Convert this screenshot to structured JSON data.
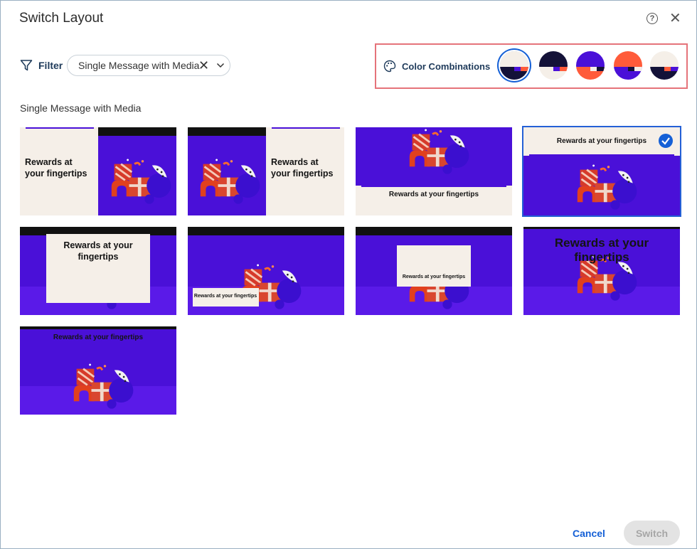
{
  "dialog": {
    "title": "Switch Layout",
    "help_icon": "help-circle-icon",
    "close_icon": "close-icon"
  },
  "filter": {
    "label": "Filter",
    "icon": "filter-funnel-icon",
    "selected": "Single Message with Media"
  },
  "color_combinations": {
    "label": "Color Combinations",
    "icon": "palette-icon",
    "swatches": [
      {
        "name": "cream-navy-purple-orange",
        "colors": [
          "#f5efe8",
          "#141238",
          "#4a10d8",
          "#ff5b3a"
        ],
        "selected": true
      },
      {
        "name": "navy-cream-purple-orange",
        "colors": [
          "#141238",
          "#f5efe8",
          "#4a10d8",
          "#ff5b3a"
        ],
        "selected": false
      },
      {
        "name": "purple-orange-cream-navy",
        "colors": [
          "#4a10d8",
          "#ff5b3a",
          "#f5efe8",
          "#141238"
        ],
        "selected": false
      },
      {
        "name": "orange-purple-navy-cream",
        "colors": [
          "#ff5b3a",
          "#4a10d8",
          "#141238",
          "#f5efe8"
        ],
        "selected": false
      },
      {
        "name": "cream-navy-orange-purple",
        "colors": [
          "#f5efe8",
          "#141238",
          "#ff5b3a",
          "#4a10d8"
        ],
        "selected": false
      }
    ]
  },
  "section": {
    "label": "Single Message with Media"
  },
  "layouts": [
    {
      "caption": "Rewards at your fingertips",
      "style": "left-text",
      "selected": false
    },
    {
      "caption": "Rewards at your fingertips",
      "style": "right-text",
      "selected": false
    },
    {
      "caption": "Rewards at your fingertips",
      "style": "bottom-banner",
      "selected": false
    },
    {
      "caption": "Rewards at your fingertips",
      "style": "top-banner",
      "selected": true
    },
    {
      "caption": "Rewards at your fingertips",
      "style": "center-card-large",
      "selected": false
    },
    {
      "caption": "Rewards at your fingertips",
      "style": "bottom-left-tag",
      "selected": false
    },
    {
      "caption": "Rewards at your fingertips",
      "style": "center-card-small",
      "selected": false
    },
    {
      "caption": "Rewards at your fingertips",
      "style": "overlay-large",
      "selected": false
    },
    {
      "caption": "Rewards at your fingertips",
      "style": "overlay-small",
      "selected": false
    }
  ],
  "footer": {
    "cancel_label": "Cancel",
    "switch_label": "Switch"
  }
}
